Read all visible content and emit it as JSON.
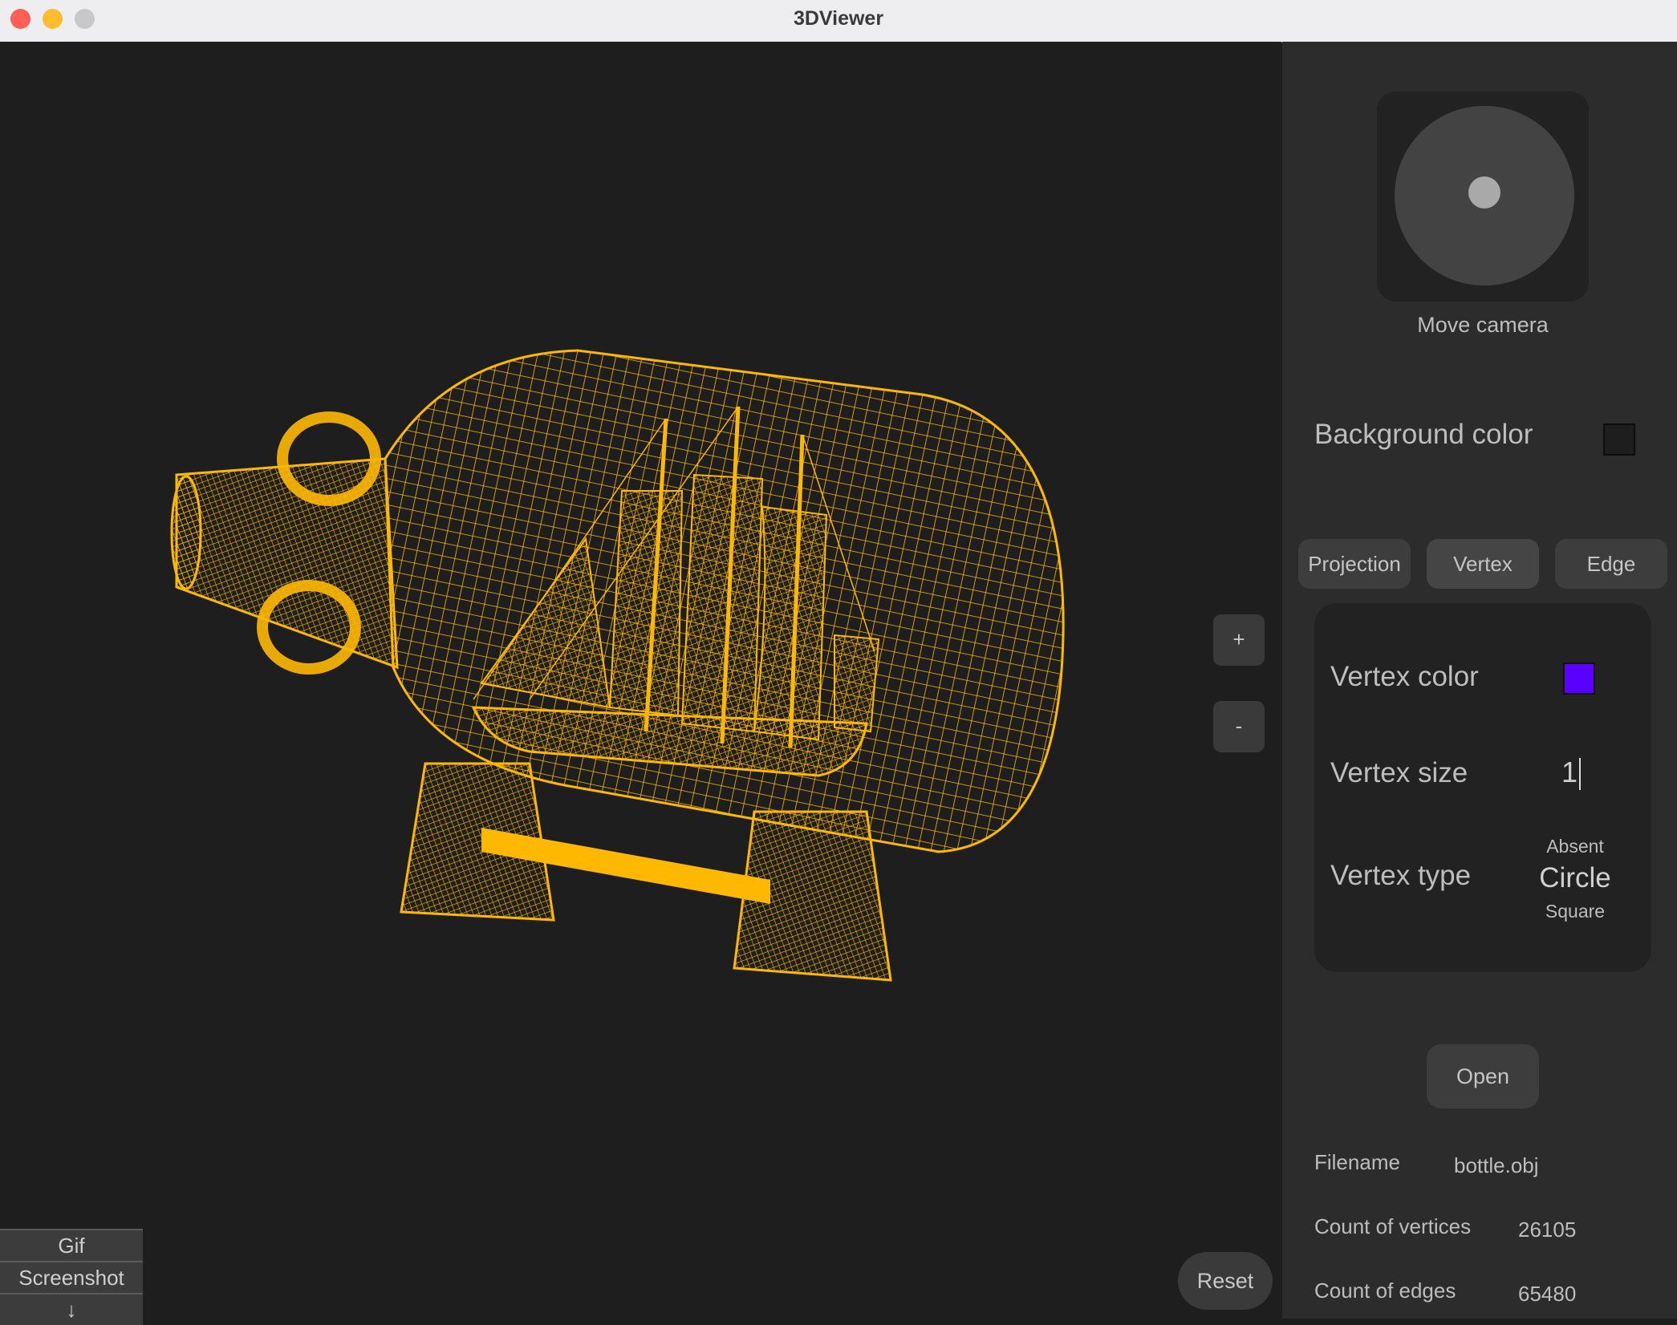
{
  "window": {
    "title": "3DViewer"
  },
  "viewport": {
    "zoom_in_label": "+",
    "zoom_out_label": "-",
    "reset_label": "Reset",
    "model_colors": {
      "edge": "#ffb800",
      "vertex": "#c070ff"
    }
  },
  "export_menu": {
    "gif_label": "Gif",
    "screenshot_label": "Screenshot",
    "expand_glyph": "↓"
  },
  "camera": {
    "label": "Move camera"
  },
  "background": {
    "label": "Background color",
    "color": "#1e1e1e"
  },
  "tabs": [
    {
      "label": "Projection"
    },
    {
      "label": "Vertex"
    },
    {
      "label": "Edge"
    }
  ],
  "vertex_panel": {
    "color_label": "Vertex color",
    "color_value": "#5a00ff",
    "size_label": "Vertex size",
    "size_value": "1",
    "type_label": "Vertex type",
    "type_options": {
      "above": "Absent",
      "selected": "Circle",
      "below": "Square"
    }
  },
  "file": {
    "open_label": "Open",
    "filename_label": "Filename",
    "filename_value": "bottle.obj",
    "vertices_label": "Count of vertices",
    "vertices_value": "26105",
    "edges_label": "Count of edges",
    "edges_value": "65480"
  }
}
